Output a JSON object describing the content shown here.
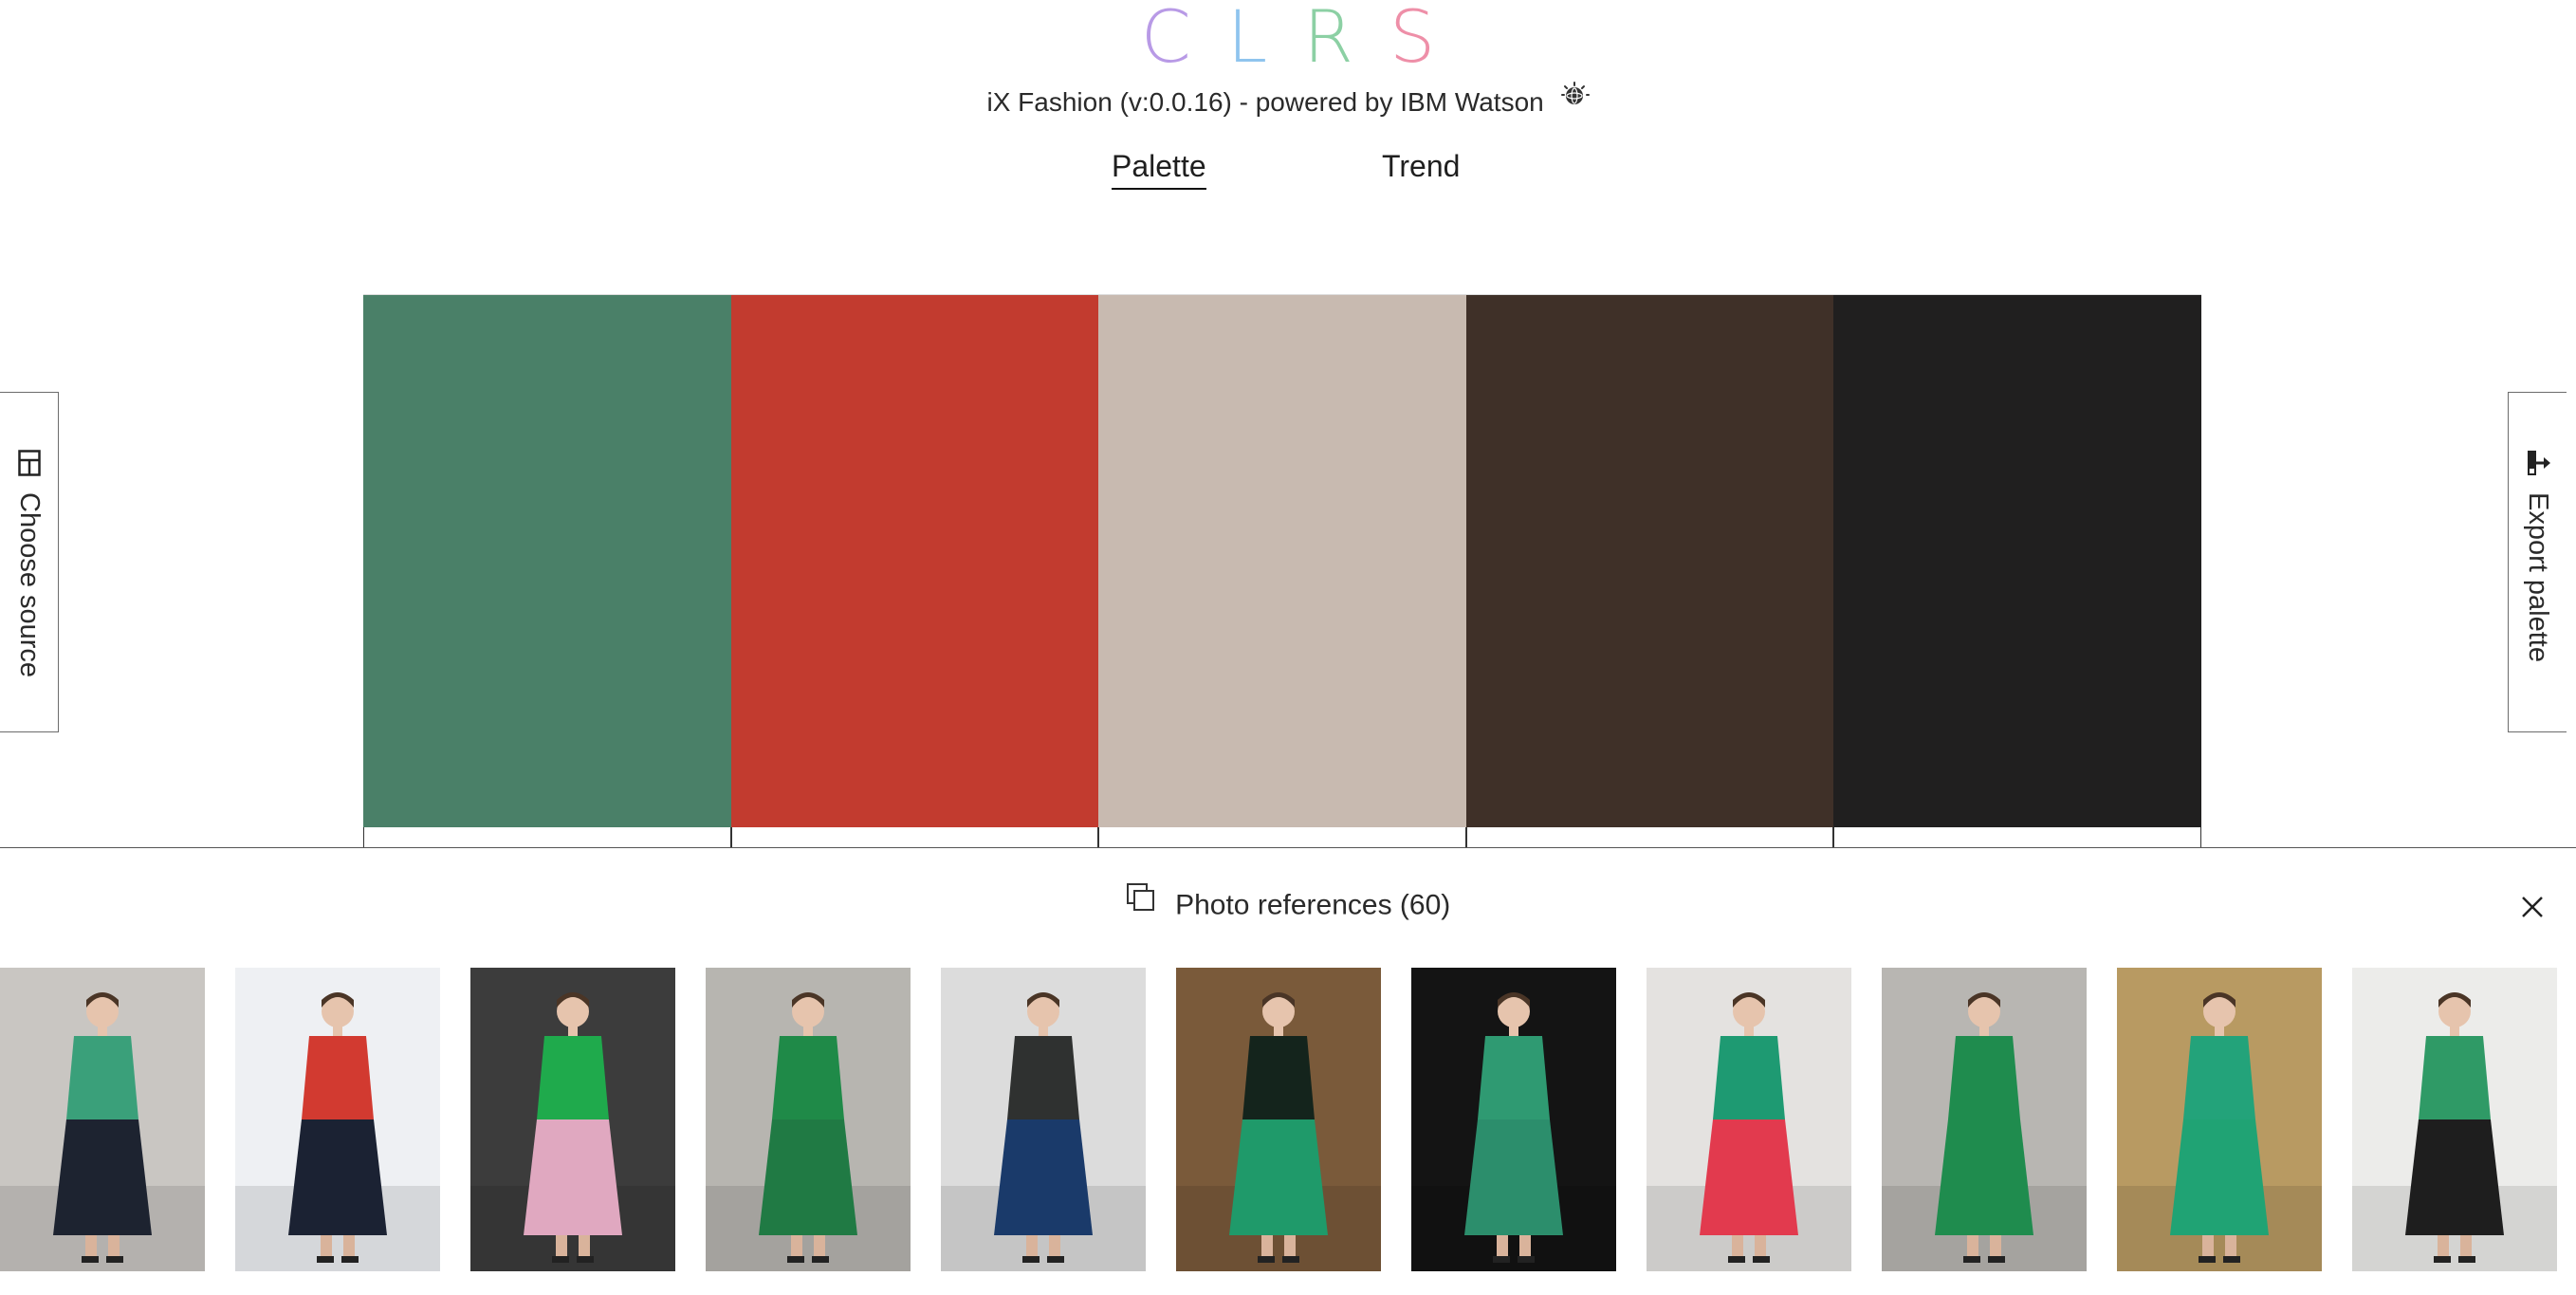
{
  "app": {
    "logo_letters": [
      "C",
      "L",
      "R",
      "S"
    ],
    "logo_colors": [
      "#b89ae6",
      "#8fc4ee",
      "#8cd0a4",
      "#ee8fa8"
    ],
    "subtitle": "iX Fashion (v:0.0.16) - powered by IBM Watson",
    "subtitle_icon": "watson-icon"
  },
  "tabs": [
    {
      "label": "Palette",
      "active": true
    },
    {
      "label": "Trend",
      "active": false
    }
  ],
  "palette": {
    "swatches": [
      "#4a8068",
      "#c23b2f",
      "#c8bab0",
      "#3f3028",
      "#201f1f"
    ]
  },
  "side_left": {
    "label": "Choose source",
    "icon": "source-icon"
  },
  "side_right": {
    "label": "Export palette",
    "icon": "export-icon"
  },
  "photo_refs": {
    "title": "Photo references (60)",
    "icon": "copy-icon",
    "close_icon": "close-icon",
    "thumbnails": [
      {
        "bg": "#c9c6c2",
        "top": "#3aa07a",
        "bottom": "#1d2330"
      },
      {
        "bg": "#eef0f3",
        "top": "#d23a30",
        "bottom": "#1b2233"
      },
      {
        "bg": "#3c3c3c",
        "top": "#1faa4c",
        "bottom": "#e0a8c0"
      },
      {
        "bg": "#b7b5b0",
        "top": "#1f8a48",
        "bottom": "#207a44"
      },
      {
        "bg": "#dcdcdc",
        "top": "#2f3130",
        "bottom": "#1a3a6a"
      },
      {
        "bg": "#7a5a3a",
        "top": "#14241c",
        "bottom": "#1f9a6a"
      },
      {
        "bg": "#141414",
        "top": "#2f9a72",
        "bottom": "#2c8e6c"
      },
      {
        "bg": "#e4e2e0",
        "top": "#1e9a72",
        "bottom": "#e23a4e"
      },
      {
        "bg": "#b8b6b2",
        "top": "#1f8c4e",
        "bottom": "#1f8c4e"
      },
      {
        "bg": "#b89a62",
        "top": "#23a37a",
        "bottom": "#20a374"
      },
      {
        "bg": "#ececea",
        "top": "#2f9a66",
        "bottom": "#1e1e1e"
      }
    ]
  }
}
